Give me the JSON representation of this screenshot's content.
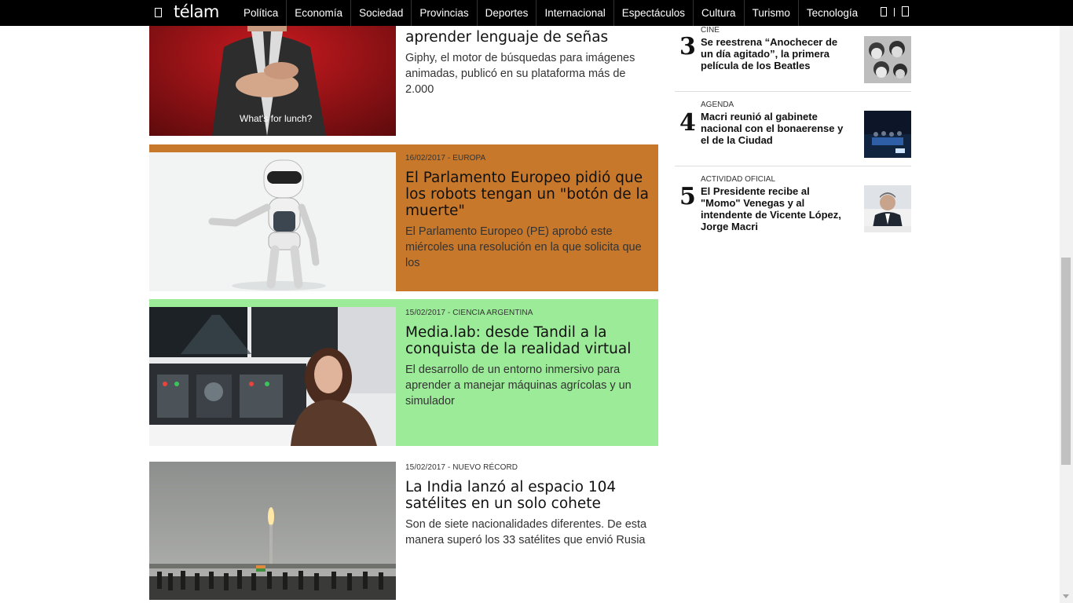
{
  "header": {
    "logo": "télam",
    "nav": [
      "Política",
      "Economía",
      "Sociedad",
      "Provincias",
      "Deportes",
      "Internacional",
      "Espectáculos",
      "Cultura",
      "Turismo",
      "Tecnología"
    ],
    "icons": [
      "menu-icon",
      "facebook-icon",
      "twitter-icon"
    ]
  },
  "articles": [
    {
      "title": "aprender lenguaje de señas",
      "summary": "Giphy, el motor de búsquedas para imágenes animadas, publicó en su plataforma más de 2.000",
      "image_caption": "What's for lunch?",
      "bg": "#ffffff"
    },
    {
      "meta": "16/02/2017 - EUROPA",
      "title": "El Parlamento Europeo pidió que los robots tengan un \"botón de la muerte\"",
      "summary": "El Parlamento Europeo (PE) aprobó este miércoles una resolución en la que solicita que los",
      "bg": "#c8782b"
    },
    {
      "meta": "15/02/2017 - CIENCIA ARGENTINA",
      "title": "Media.lab: desde Tandil a la conquista de la realidad virtual",
      "summary": "El desarrollo de un entorno inmersivo para aprender a manejar máquinas agrícolas y un simulador",
      "bg": "#9ceb98"
    },
    {
      "meta": "15/02/2017 - NUEVO RÉCORD",
      "title": "La India lanzó al espacio 104 satélites en un solo cohete",
      "summary": "Son de siete nacionalidades diferentes. De esta manera superó los 33 satélites que envió Rusia",
      "bg": "#ffffff"
    }
  ],
  "sidebar": [
    {
      "num": "3",
      "category": "CINE",
      "title": "Se reestrena “Anochecer de un día agitado”, la primera película de los Beatles"
    },
    {
      "num": "4",
      "category": "AGENDA",
      "title": "Macri reunió al gabinete nacional con el bonaerense y el de la Ciudad"
    },
    {
      "num": "5",
      "category": "ACTIVIDAD OFICIAL",
      "title": "El Presidente recibe al \"Momo\" Venegas y al intendente de Vicente López, Jorge Macri"
    }
  ]
}
